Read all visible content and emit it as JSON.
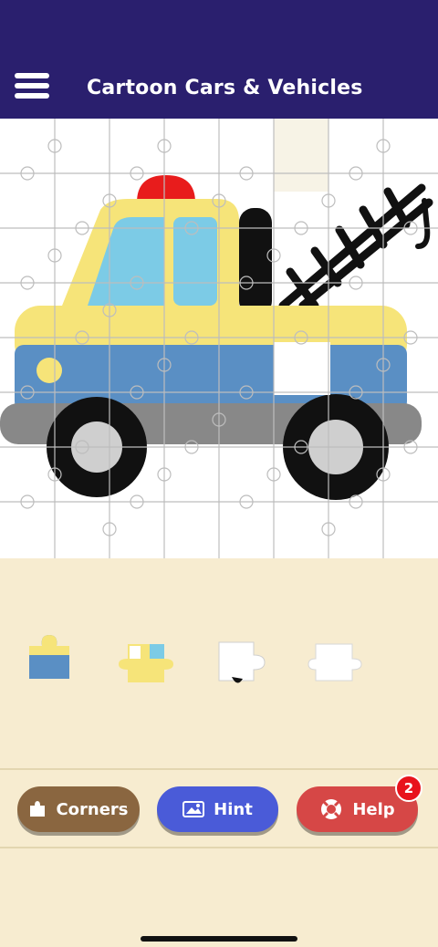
{
  "header": {
    "title": "Cartoon Cars & Vehicles",
    "menu_icon": "hamburger-menu-icon",
    "background": "#2a1f6e"
  },
  "puzzle": {
    "image_subject": "tow truck",
    "colors": {
      "body": "#f6e479",
      "lower_body": "#5a8fc4",
      "window": "#7ccbe6",
      "siren": "#e81c1c",
      "wheel": "#111111",
      "hub": "#cfcfcf",
      "bumper": "#888888"
    }
  },
  "tray": {
    "pieces": [
      {
        "icon": "blue-yellow-piece-icon"
      },
      {
        "icon": "yellow-blue-piece-icon"
      },
      {
        "icon": "white-black-piece-icon"
      },
      {
        "icon": "white-piece-icon"
      }
    ]
  },
  "toolbar": {
    "corners_label": "Corners",
    "hint_label": "Hint",
    "help_label": "Help",
    "help_badge": "2",
    "corners_icon": "puzzle-piece-icon",
    "hint_icon": "image-icon",
    "help_icon": "lifebuoy-icon",
    "colors": {
      "corners": "#8a6640",
      "hint": "#4a5bd8",
      "help": "#d64746"
    }
  }
}
